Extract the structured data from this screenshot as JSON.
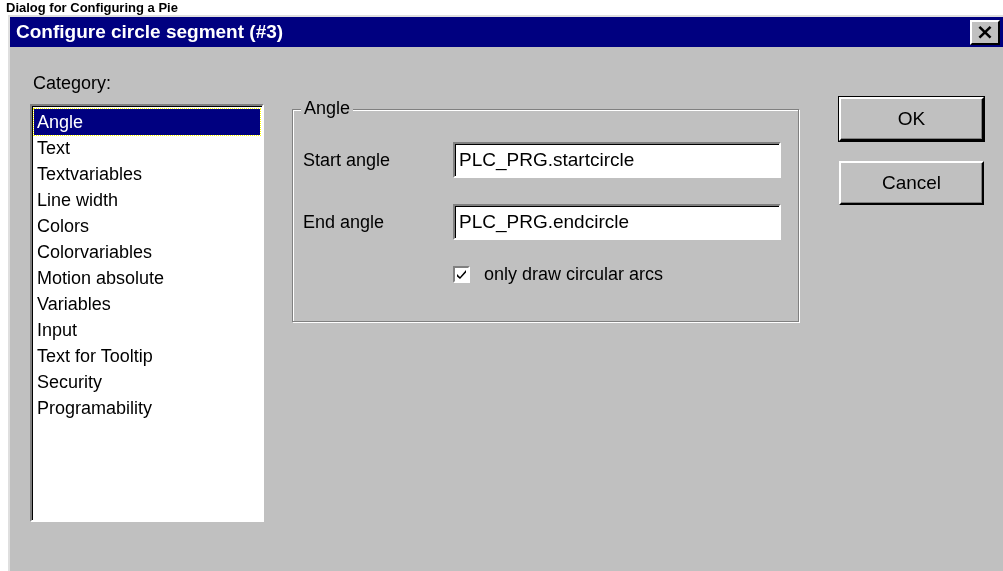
{
  "caption": "Dialog for Configuring a Pie",
  "window": {
    "title": "Configure circle segment (#3)",
    "close": "×"
  },
  "category_label": "Category:",
  "categories": [
    {
      "label": "Angle",
      "selected": true
    },
    {
      "label": "Text",
      "selected": false
    },
    {
      "label": "Textvariables",
      "selected": false
    },
    {
      "label": "Line width",
      "selected": false
    },
    {
      "label": "Colors",
      "selected": false
    },
    {
      "label": "Colorvariables",
      "selected": false
    },
    {
      "label": "Motion absolute",
      "selected": false
    },
    {
      "label": "Variables",
      "selected": false
    },
    {
      "label": "Input",
      "selected": false
    },
    {
      "label": "Text for Tooltip",
      "selected": false
    },
    {
      "label": "Security",
      "selected": false
    },
    {
      "label": "Programability",
      "selected": false
    }
  ],
  "group": {
    "title": "Angle",
    "fields": [
      {
        "label": "Start angle",
        "value": "PLC_PRG.startcircle"
      },
      {
        "label": "End angle",
        "value": "PLC_PRG.endcircle"
      }
    ],
    "checkbox": {
      "label": "only draw circular arcs",
      "checked": true
    }
  },
  "buttons": [
    {
      "label": "OK",
      "default": true
    },
    {
      "label": "Cancel",
      "default": false
    }
  ]
}
